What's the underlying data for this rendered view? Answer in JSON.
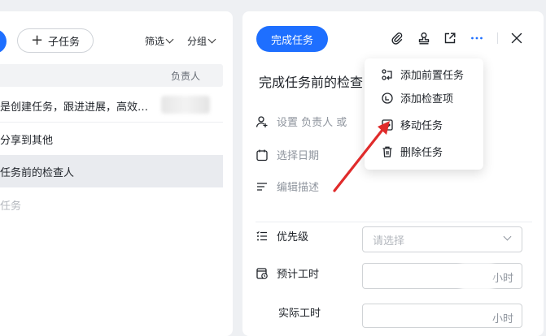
{
  "left_panel": {
    "subtask_button": "子任务",
    "filter_label": "筛选",
    "group_label": "分组",
    "column_assignee": "负责人",
    "rows": [
      {
        "text": "是创建任务，跟进进展，高效…"
      },
      {
        "text": "分享到其他"
      },
      {
        "text": "任务前的检查人"
      },
      {
        "text": "任务"
      }
    ]
  },
  "right_panel": {
    "complete_button": "完成任务",
    "task_title": "完成任务前的检查",
    "assignee_placeholder": "设置 负责人 或",
    "date_placeholder": "选择日期",
    "description_placeholder": "编辑描述",
    "priority_label": "优先级",
    "priority_select_placeholder": "请选择",
    "estimated_hours_label": "预计工时",
    "actual_hours_label": "实际工时",
    "hours_unit": "小时"
  },
  "dropdown_menu": {
    "items": [
      {
        "label": "添加前置任务",
        "icon": "predecessor-icon"
      },
      {
        "label": "添加检查项",
        "icon": "checklist-icon"
      },
      {
        "label": "移动任务",
        "icon": "move-icon"
      },
      {
        "label": "删除任务",
        "icon": "trash-icon"
      }
    ]
  },
  "colors": {
    "accent": "#1e6fff",
    "annotation_arrow": "#e02b2b"
  }
}
